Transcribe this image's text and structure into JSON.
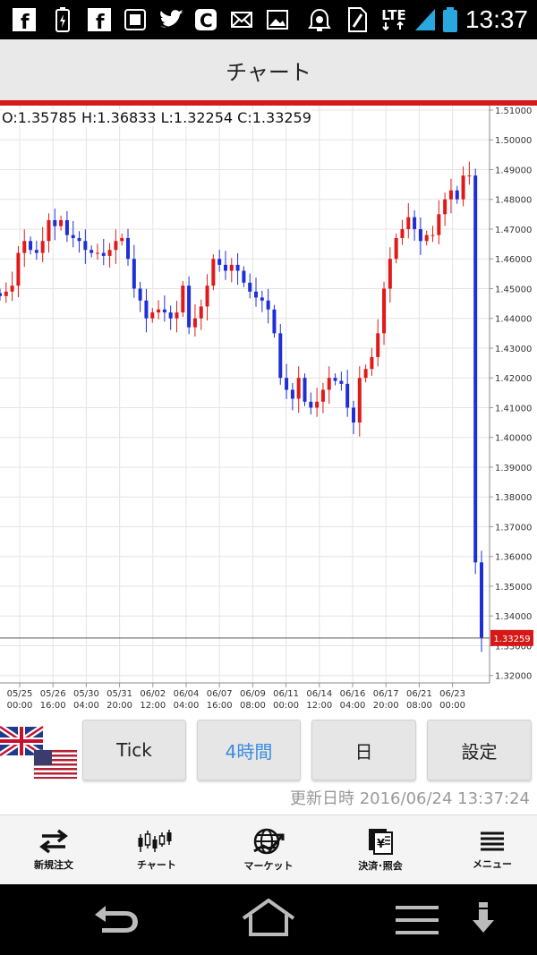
{
  "status_bar": {
    "time": "13:37",
    "network": "LTE",
    "icons": [
      "facebook-icon",
      "battery-charge-icon",
      "facebook-icon",
      "app-icon",
      "twitter-icon",
      "app-icon",
      "mail-icon",
      "image-icon",
      "notification-icon",
      "sim-icon"
    ]
  },
  "title": "チャート",
  "ohlc": "O:1.35785 H:1.36833 L:1.32254 C:1.33259",
  "current_price": "1.33259",
  "colors": {
    "up": "#e01a1a",
    "down": "#1f2fd6",
    "accent": "#d71818",
    "active": "#3a8be0"
  },
  "chart_data": {
    "type": "candlestick",
    "y_ticks": [
      "1.51000",
      "1.50000",
      "1.49000",
      "1.48000",
      "1.47000",
      "1.46000",
      "1.45000",
      "1.44000",
      "1.43000",
      "1.42000",
      "1.41000",
      "1.40000",
      "1.39000",
      "1.38000",
      "1.37000",
      "1.36000",
      "1.35000",
      "1.34000",
      "1.33000",
      "1.32000"
    ],
    "x_ticks": [
      [
        "05/25",
        "00:00"
      ],
      [
        "05/26",
        "16:00"
      ],
      [
        "05/30",
        "04:00"
      ],
      [
        "05/31",
        "20:00"
      ],
      [
        "06/02",
        "12:00"
      ],
      [
        "06/04",
        "04:00"
      ],
      [
        "06/07",
        "16:00"
      ],
      [
        "06/09",
        "08:00"
      ],
      [
        "06/11",
        "00:00"
      ],
      [
        "06/14",
        "12:00"
      ],
      [
        "06/16",
        "04:00"
      ],
      [
        "06/17",
        "20:00"
      ],
      [
        "06/21",
        "08:00"
      ],
      [
        "06/23",
        "00:00"
      ]
    ],
    "ylim": [
      1.3175,
      1.5115
    ],
    "close_path": [
      1.4475,
      1.449,
      1.451,
      1.462,
      1.466,
      1.463,
      1.462,
      1.466,
      1.473,
      1.471,
      1.473,
      1.468,
      1.467,
      1.466,
      1.463,
      1.462,
      1.462,
      1.461,
      1.463,
      1.466,
      1.467,
      1.46,
      1.45,
      1.446,
      1.44,
      1.442,
      1.443,
      1.442,
      1.44,
      1.442,
      1.451,
      1.437,
      1.44,
      1.444,
      1.451,
      1.46,
      1.458,
      1.456,
      1.458,
      1.456,
      1.452,
      1.449,
      1.447,
      1.446,
      1.443,
      1.435,
      1.42,
      1.416,
      1.413,
      1.42,
      1.412,
      1.41,
      1.412,
      1.416,
      1.42,
      1.419,
      1.418,
      1.41,
      1.405,
      1.42,
      1.423,
      1.427,
      1.435,
      1.45,
      1.46,
      1.467,
      1.47,
      1.474,
      1.47,
      1.466,
      1.468,
      1.468,
      1.475,
      1.48,
      1.483,
      1.48,
      1.488,
      1.488,
      1.358,
      1.33259
    ]
  },
  "buttons": {
    "tick": "Tick",
    "h4": "4時間",
    "day": "日",
    "settings": "設定"
  },
  "update_time": "更新日時 2016/06/24 13:37:24",
  "nav": {
    "new_order": "新規注文",
    "chart": "チャート",
    "market": "マーケット",
    "settle": "決済･照会",
    "menu": "メニュー"
  }
}
